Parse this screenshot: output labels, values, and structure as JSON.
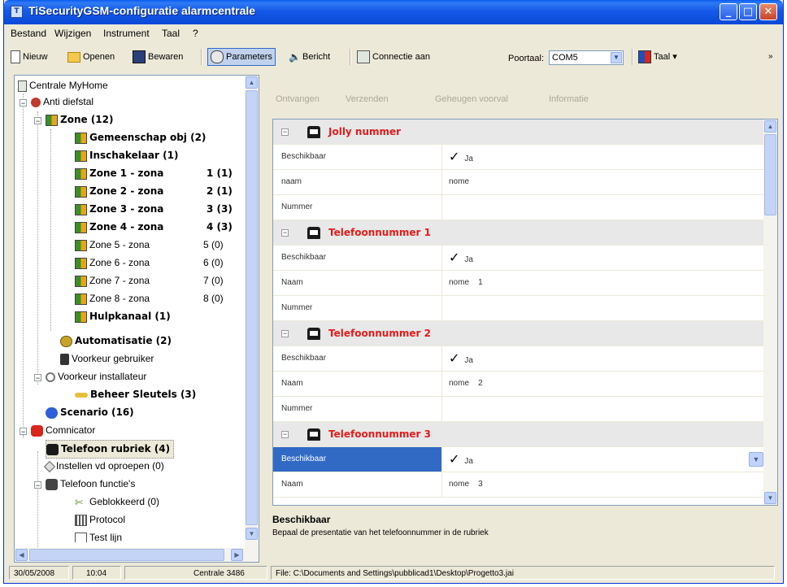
{
  "window": {
    "title": "TiSecurityGSM-configuratie  alarmcentrale",
    "app_icon": "app-icon",
    "buttons": [
      "minimize",
      "maximize",
      "close"
    ]
  },
  "menu": {
    "items": [
      "Bestand",
      "Wijzigen",
      "Instrument",
      "Taal",
      "?"
    ]
  },
  "toolbar": {
    "new": "Nieuw",
    "open": "Openen",
    "save": "Bewaren",
    "parameters": "Parameters",
    "message": "Bericht",
    "connect": "Connectie aan",
    "port_label": "Poortaal:",
    "port_value": "COM5",
    "language": "Taal",
    "overflow": "»"
  },
  "tree": {
    "root": "Centrale MyHome",
    "anti_theft": "Anti diefstal",
    "zone": "Zone (12)",
    "zone_items": [
      {
        "label": "Gemeenschap obj (2)",
        "count": "",
        "bold": true
      },
      {
        "label": "Inschakelaar (1)",
        "count": "",
        "bold": true
      },
      {
        "label": "Zone 1 - zona",
        "count": "1 (1)",
        "bold": true
      },
      {
        "label": "Zone 2 - zona",
        "count": "2 (1)",
        "bold": true
      },
      {
        "label": "Zone 3 - zona",
        "count": "3 (3)",
        "bold": true
      },
      {
        "label": "Zone 4 - zona",
        "count": "4 (3)",
        "bold": true
      },
      {
        "label": "Zone 5 - zona",
        "count": "5 (0)",
        "bold": false
      },
      {
        "label": "Zone 6 - zona",
        "count": "6 (0)",
        "bold": false
      },
      {
        "label": "Zone 7 - zona",
        "count": "7 (0)",
        "bold": false
      },
      {
        "label": "Zone 8 - zona",
        "count": "8 (0)",
        "bold": false
      },
      {
        "label": "Hulpkanaal (1)",
        "count": "",
        "bold": true
      }
    ],
    "automation": "Automatisatie (2)",
    "user_pref": "Voorkeur gebruiker",
    "installer_pref": "Voorkeur installateur",
    "key_mgmt": "Beheer Sleutels (3)",
    "scenario": "Scenario (16)",
    "communicator": "Comnicator",
    "phone_book": "Telefoon rubriek (4)",
    "call_settings": "Instellen vd oproepen (0)",
    "phone_functions": "Telefoon functie's",
    "blocked": "Geblokkeerd (0)",
    "protocol": "Protocol",
    "test_line": "Test lijn"
  },
  "panel_toolbar": {
    "receive": "Ontvangen",
    "send": "Verzenden",
    "memory": "Geheugen voorval",
    "info": "Informatie"
  },
  "grid": {
    "sections": [
      {
        "title": "Jolly nummer",
        "rows": [
          {
            "key": "Beschikbaar",
            "check": "✓",
            "value": "Ja"
          },
          {
            "key": "naam",
            "check": "",
            "value": "nome"
          },
          {
            "key": "Nummer",
            "check": "",
            "value": ""
          }
        ]
      },
      {
        "title": "Telefoonnummer 1",
        "rows": [
          {
            "key": "Beschikbaar",
            "check": "✓",
            "value": "Ja"
          },
          {
            "key": "Naam",
            "check": "",
            "value": "nome    1"
          },
          {
            "key": "Nummer",
            "check": "",
            "value": ""
          }
        ]
      },
      {
        "title": "Telefoonnummer 2",
        "rows": [
          {
            "key": "Beschikbaar",
            "check": "✓",
            "value": "Ja"
          },
          {
            "key": "Naam",
            "check": "",
            "value": "nome    2"
          },
          {
            "key": "Nummer",
            "check": "",
            "value": ""
          }
        ]
      },
      {
        "title": "Telefoonnummer 3",
        "rows": [
          {
            "key": "Beschikbaar",
            "check": "✓",
            "value": "Ja"
          },
          {
            "key": "Naam",
            "check": "",
            "value": "nome    3"
          }
        ]
      }
    ]
  },
  "description": {
    "title": "Beschikbaar",
    "text": "Bepaal de presentatie van het telefoonnummer in de rubriek"
  },
  "status": {
    "date": "30/05/2008",
    "time": "10:04",
    "central": "Centrale 3486",
    "file": "File: C:\\Documents and Settings\\pubblicad1\\Desktop\\Progetto3.jai"
  },
  "colors": {
    "title_bar": "#0a5cf0",
    "section_title": "#e31b1b",
    "selection": "#316ac5"
  }
}
